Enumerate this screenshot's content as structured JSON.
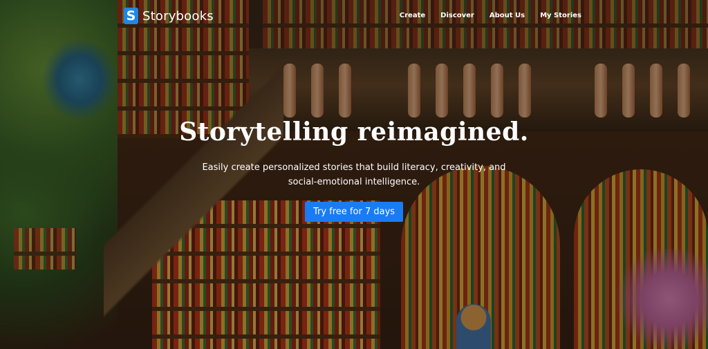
{
  "brand": {
    "icon_letter": "S",
    "name": "Storybooks"
  },
  "nav": {
    "items": [
      {
        "label": "Create"
      },
      {
        "label": "Discover"
      },
      {
        "label": "About Us"
      },
      {
        "label": "My Stories"
      }
    ]
  },
  "hero": {
    "title": "Storytelling reimagined.",
    "subtitle": "Easily create personalized stories that build literacy, creativity, and social-emotional intelligence.",
    "cta_label": "Try free for 7 days"
  },
  "colors": {
    "accent": "#1a7cf5",
    "brand_icon": "#1e88e5"
  }
}
